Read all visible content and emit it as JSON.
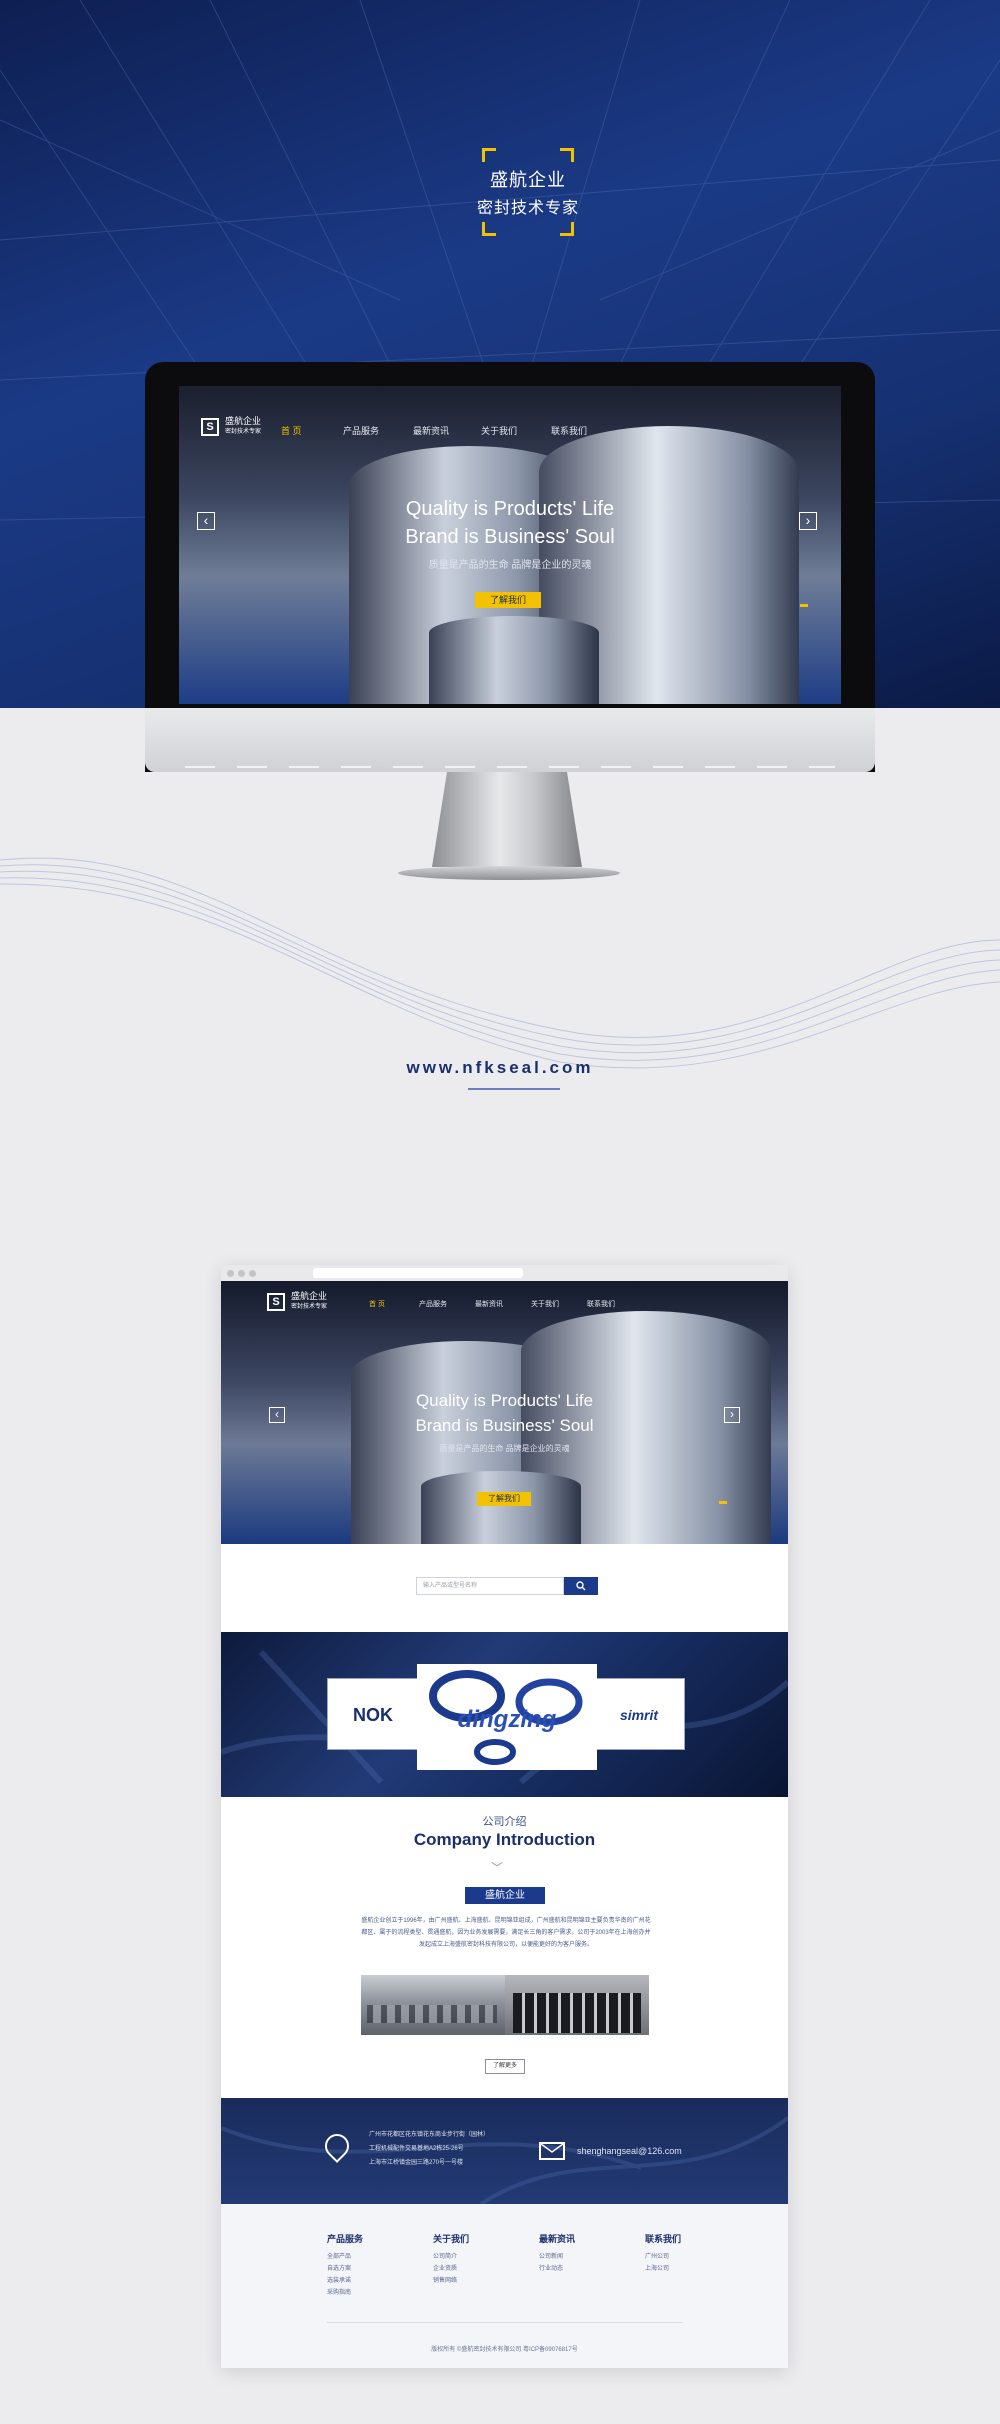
{
  "brand": {
    "name": "盛航企业",
    "tagline": "密封技术专家"
  },
  "nav": {
    "logo_mark": "S",
    "logo_name": "盛航企业",
    "logo_tagline": "密封技术专家",
    "items": [
      "首 页",
      "产品服务",
      "最新资讯",
      "关于我们",
      "联系我们"
    ]
  },
  "slider": {
    "line1": "Quality is Products' Life",
    "line2": "Brand is Business' Soul",
    "cn": "质量是产品的生命 品牌是企业的灵魂",
    "cta": "了解我们",
    "prev": "‹",
    "next": "›"
  },
  "url": "www.nfkseal.com",
  "search": {
    "placeholder": "输入产品或型号名称",
    "button_icon": "search-icon"
  },
  "brands": [
    "NOK",
    "dingzing",
    "simrit"
  ],
  "intro": {
    "cn": "公司介绍",
    "en": "Company Introduction",
    "chevron": "﹀",
    "badge": "盛航企业",
    "paragraph": "盛航企业创立于1996年，由广州盛航、上海盛航、昆明锦亚组成，广州盛航和昆明锦亚主要负责华南的广州花都区、属于的流程类型、贯通盛航，因为业务发展需要，满足长三角的客户需求，公司于2003年在上海创办并发起成立上海盛航密封科技有限公司，以便能更好的为客户服务。",
    "more": "了解更多"
  },
  "contact": {
    "addresses": [
      "广州市花都区花东镇花东商业步行街（园林）",
      "工程机械配件交易基地A2栋25-26号",
      "上海市江桥镇金园三路270号一号楼"
    ],
    "email": "shenghangseal@126.com"
  },
  "footer": {
    "columns": [
      {
        "title": "产品服务",
        "items": [
          "全部产品",
          "自选方案",
          "选装承诺",
          "采购指南"
        ]
      },
      {
        "title": "关于我们",
        "items": [
          "公司简介",
          "企业资质",
          "销售网络"
        ]
      },
      {
        "title": "最新资讯",
        "items": [
          "公司新闻",
          "行业动态"
        ]
      },
      {
        "title": "联系我们",
        "items": [
          "广州公司",
          "上海公司"
        ]
      }
    ],
    "copyright": "版权所有 ©盛航密封技术有限公司   粤ICP备09076817号"
  },
  "colors": {
    "navy": "#1b2f6e",
    "accent": "#f2c200",
    "button": "#1b3a8c"
  }
}
